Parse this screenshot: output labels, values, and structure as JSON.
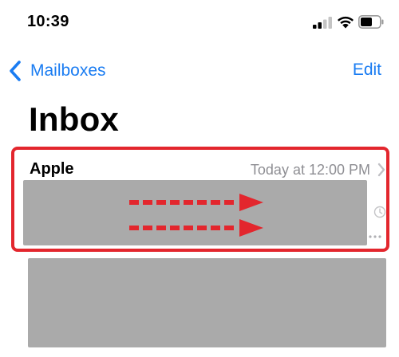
{
  "status_bar": {
    "time": "10:39",
    "icons": [
      "signal-icon",
      "wifi-icon",
      "battery-icon"
    ]
  },
  "nav": {
    "back_label": "Mailboxes",
    "edit_label": "Edit"
  },
  "page": {
    "title": "Inbox"
  },
  "messages": [
    {
      "sender": "Apple",
      "timestamp": "Today at 12:00 PM"
    }
  ],
  "colors": {
    "accent": "#1a7cf2",
    "highlight": "#e3262d",
    "arrow": "#e3262d",
    "redaction": "#aaaaaa",
    "secondary_text": "#8e8e93"
  }
}
